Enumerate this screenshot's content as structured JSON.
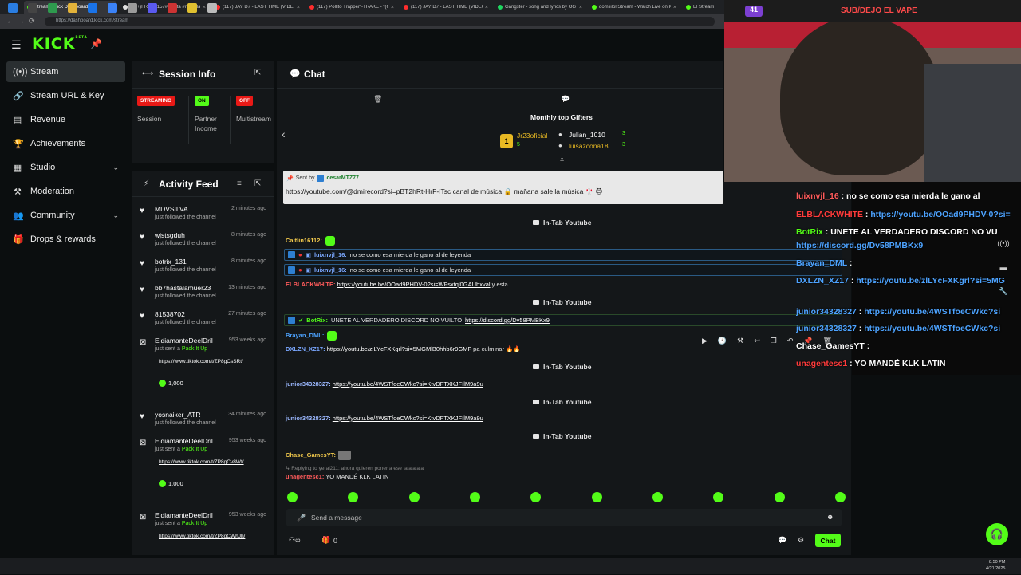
{
  "browser": {
    "tabs": [
      {
        "title": "Stream - Kick Dashboard",
        "color": "#53fc18",
        "active": true
      },
      {
        "title": "(99+)FRUTA157#lafruta #reydela...",
        "color": "#e0e0e0"
      },
      {
        "title": "(117) JAY D7 - LAST TIME (VIDEO...",
        "color": "#ff2d2d"
      },
      {
        "title": "(117) Pollito Trapper\"-TRAKE - \"(Off...",
        "color": "#ff2d2d"
      },
      {
        "title": "(117) JAY D7 - LAST TIME (VIDEO C...",
        "color": "#ff2d2d"
      },
      {
        "title": "Gangster - song and lyrics by OG F...",
        "color": "#1ed760"
      },
      {
        "title": "domiiilol Stream - Watch Live on K...",
        "color": "#53fc18"
      },
      {
        "title": "El Stream",
        "color": "#53fc18"
      }
    ],
    "url": "https://dashboard.kick.com/stream"
  },
  "sidebar": {
    "items": [
      {
        "label": "Stream",
        "icon": "broadcast-icon",
        "glyph": "((•))",
        "active": true
      },
      {
        "label": "Stream URL & Key",
        "icon": "link-icon",
        "glyph": "🔗"
      },
      {
        "label": "Revenue",
        "icon": "revenue-icon",
        "glyph": "▤"
      },
      {
        "label": "Achievements",
        "icon": "trophy-icon",
        "glyph": "🏆"
      },
      {
        "label": "Studio",
        "icon": "studio-icon",
        "glyph": "▦",
        "chevron": true
      },
      {
        "label": "Moderation",
        "icon": "hammer-icon",
        "glyph": "⚒"
      },
      {
        "label": "Community",
        "icon": "community-icon",
        "glyph": "👥",
        "chevron": true
      },
      {
        "label": "Drops & rewards",
        "icon": "gift-icon",
        "glyph": "🎁"
      }
    ]
  },
  "session": {
    "title": "Session Info",
    "badges": [
      {
        "text": "STREAMING",
        "color": "#e91916",
        "label": "Session"
      },
      {
        "text": "ON",
        "color": "#53fc18",
        "label": "Partner Income"
      },
      {
        "text": "OFF",
        "color": "#e91916",
        "label": "Multistream"
      }
    ]
  },
  "activity": {
    "title": "Activity Feed",
    "items": [
      {
        "name": "MDVSILVA",
        "time": "2 minutes ago",
        "sub": "just followed the channel",
        "type": "follow"
      },
      {
        "name": "wjstsgduh",
        "time": "8 minutes ago",
        "sub": "just followed the channel",
        "type": "follow"
      },
      {
        "name": "botrix_131",
        "time": "8 minutes ago",
        "sub": "just followed the channel",
        "type": "follow"
      },
      {
        "name": "bb7hastalamuer23",
        "time": "13 minutes ago",
        "sub": "just followed the channel",
        "type": "follow"
      },
      {
        "name": "81538702",
        "time": "27 minutes ago",
        "sub": "just followed the channel",
        "type": "follow"
      },
      {
        "name": "EldiamanteDeelDril",
        "time": "953 weeks ago",
        "sub_prefix": "just sent a",
        "sub_item": "Pack It Up",
        "link": "https://www.tiktok.com/t/ZP8gCsSRt/",
        "amount": "1,000",
        "type": "gift"
      },
      {
        "name": "yosnaiker_ATR",
        "time": "34 minutes ago",
        "sub": "just followed the channel",
        "type": "follow"
      },
      {
        "name": "EldiamanteDeelDril",
        "time": "953 weeks ago",
        "sub_prefix": "just sent a",
        "sub_item": "Pack It Up",
        "link": "https://www.tiktok.com/t/ZP8gCv8Wf/",
        "amount": "1,000",
        "type": "gift"
      },
      {
        "name": "EldiamanteDeelDril",
        "time": "953 weeks ago",
        "sub_prefix": "just sent a",
        "sub_item": "Pack It Up",
        "link": "https://www.tiktok.com/t/ZP8gCWhJh/",
        "type": "gift"
      }
    ]
  },
  "chat": {
    "title": "Chat",
    "gifters_title": "Monthly top Gifters",
    "gifters": [
      {
        "name": "Jr23oficial",
        "count": "5",
        "color": "#e8b923"
      },
      {
        "name": "Julian_1010",
        "count": "3",
        "color": "#ffffff"
      },
      {
        "name": "luisazcona18",
        "count": "3",
        "color": "#e8b923"
      }
    ],
    "pinned_by_prefix": "Sent by",
    "pinned_by": "cesarMTZ77",
    "pinned_link": "https://youtube.com/@dmirecord?si=pBT2hRt-HrF-ITsc",
    "pinned_text": "canal de música 🔒 mañana sale la música 🎌 😈",
    "intab_label": "In-Tab Youtube",
    "messages": [
      {
        "user": "Caitlin16112:",
        "color": "#f2c94c",
        "text": ""
      },
      {
        "user": "luixnvjl_16:",
        "color": "#7aa7ff",
        "text": "no se como esa mierda le gano al de leyenda"
      },
      {
        "user": "luixnvjl_16:",
        "color": "#7aa7ff",
        "text": "no se como esa mierda le gano al de leyenda"
      },
      {
        "user": "ELBLACKWHITE:",
        "color": "#ff5b5b",
        "link": "https://youtube.be/OOad9PHDV-0?si=WFsxtql0GAUbxval",
        "text": "y esta"
      },
      {
        "user": "BotRix:",
        "color": "#53fc18",
        "text": "UNETE AL VERDADERO DISCORD NO VUILTO",
        "link": "https://discord.gg/Dv58PMBKx9"
      },
      {
        "user": "Brayan_DML:",
        "color": "#4da3ff",
        "text": ""
      },
      {
        "user": "DXLZN_XZ17:",
        "color": "#7aa7ff",
        "link": "https://youtu.be/zlLYcFXKgrl?si=5MGMlB0hhb6r9GMF",
        "text": "pa culminar 🔥🔥"
      },
      {
        "user": "junior34328327:",
        "color": "#9bb8ff",
        "link": "https://youtu.be/4WSTfoeCWkc?si=KtvDFTXKJFIlM9a9u"
      },
      {
        "user": "junior34328327:",
        "color": "#9bb8ff",
        "link": "https://youtu.be/4WSTfoeCWkc?si=KtvDFTXKJFIlM9a9u"
      },
      {
        "user": "Chase_GamesYT:",
        "color": "#f2c94c",
        "text": ""
      },
      {
        "user": "unagentesc1:",
        "color": "#ff5b5b",
        "text": "YO MANDÉ KLK LATIN"
      }
    ],
    "reply_note": "Replying to yerai211: ahora quieren poner a ese jajajajaja",
    "input_placeholder": "Send a message",
    "viewer_count": "0",
    "send_label": "Chat"
  },
  "overlay": {
    "banner": "SUB/DEJO EL VAPE",
    "counter": "41",
    "lines": [
      {
        "user": "luixnvjl_16",
        "color": "#ff5b5b",
        "text": "no se como esa mierda le gano al"
      },
      {
        "user": "ELBLACKWHITE",
        "color": "#ff3b3b",
        "text": "https://youtu.be/OOad9PHDV-0?si="
      },
      {
        "user": "BotRix",
        "color": "#53fc18",
        "text": "UNETE AL VERDADERO DISCORD NO VU"
      },
      {
        "user": "",
        "color": "#4da3ff",
        "text": "https://discord.gg/Dv58PMBKx9"
      },
      {
        "user": "Brayan_DML",
        "color": "#4da3ff",
        "text": ""
      },
      {
        "user": "DXLZN_XZ17",
        "color": "#4da3ff",
        "text": "https://youtu.be/zlLYcFXKgrl?si=5MG"
      },
      {
        "user": "junior34328327",
        "color": "#4da3ff",
        "text": "https://youtu.be/4WSTfoeCWkc?si"
      },
      {
        "user": "junior34328327",
        "color": "#4da3ff",
        "text": "https://youtu.be/4WSTfoeCWkc?si"
      },
      {
        "user": "Chase_GamesYT",
        "color": "#ffffff",
        "text": ""
      },
      {
        "user": "unagentesc1",
        "color": "#ff3b3b",
        "text": "YO MANDÉ KLK LATIN"
      }
    ]
  },
  "taskbar": {
    "time": "8:50 PM",
    "date": "4/21/2025"
  }
}
